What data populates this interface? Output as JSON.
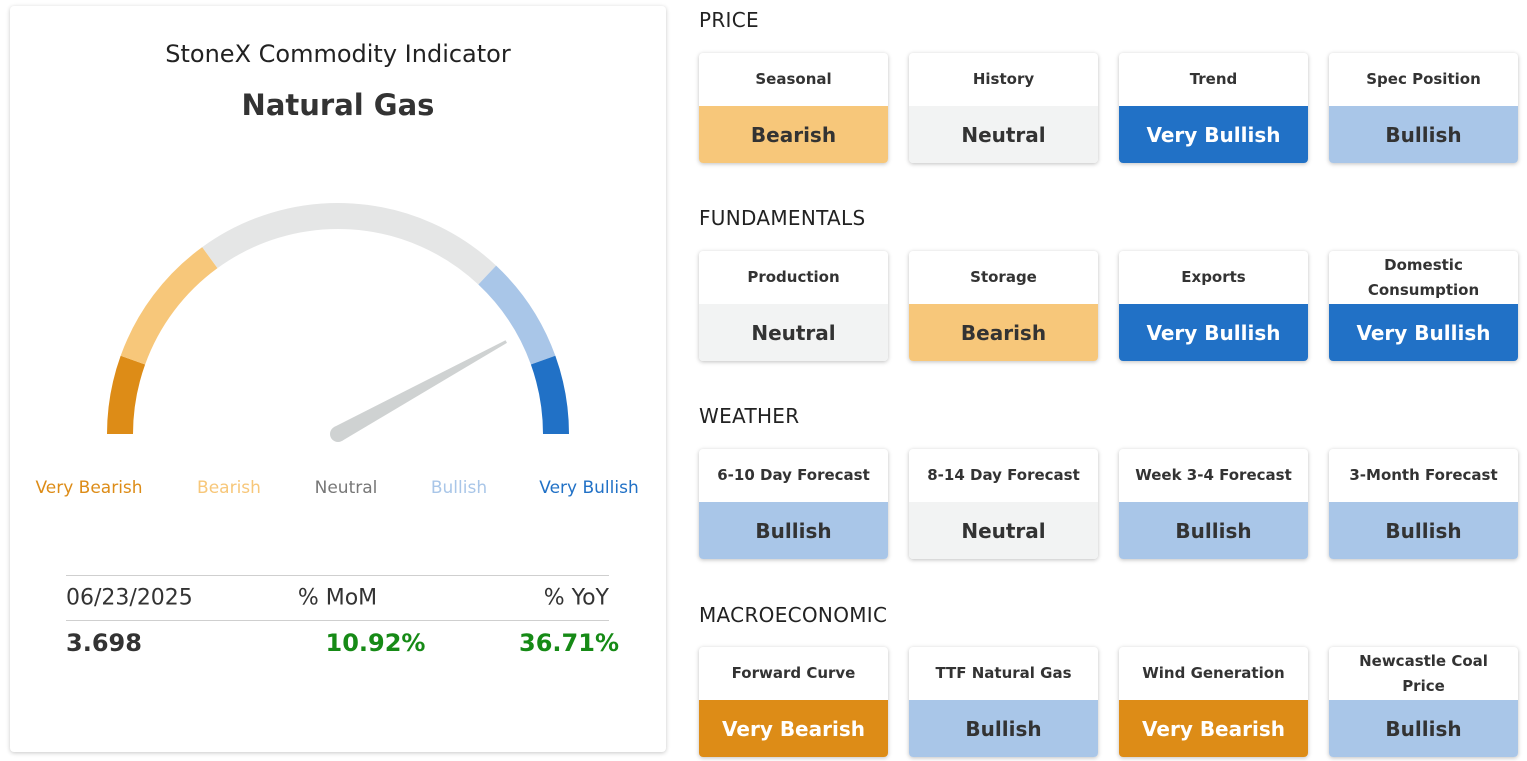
{
  "gauge": {
    "title": "StoneX Commodity Indicator",
    "commodity": "Natural Gas",
    "needle_fraction": 0.84,
    "legend": [
      {
        "label": "Very Bearish",
        "color": "#dd8c17"
      },
      {
        "label": "Bearish",
        "color": "#f7c77a"
      },
      {
        "label": "Neutral",
        "color": "#777777"
      },
      {
        "label": "Bullish",
        "color": "#a9c6e8"
      },
      {
        "label": "Very Bullish",
        "color": "#2171c6"
      }
    ],
    "arc_colors": [
      "#dd8c17",
      "#f7c77a",
      "#e5e6e6",
      "#a9c6e8",
      "#2171c6"
    ]
  },
  "stats": {
    "date": "06/23/2025",
    "mom_label": "% MoM",
    "yoy_label": "% YoY",
    "price": "3.698",
    "mom_value": "10.92%",
    "yoy_value": "36.71%"
  },
  "sections": [
    {
      "title": "PRICE",
      "items": [
        {
          "name": "Seasonal",
          "value": "Bearish"
        },
        {
          "name": "History",
          "value": "Neutral"
        },
        {
          "name": "Trend",
          "value": "Very Bullish"
        },
        {
          "name": "Spec Position",
          "value": "Bullish"
        }
      ]
    },
    {
      "title": "FUNDAMENTALS",
      "items": [
        {
          "name": "Production",
          "value": "Neutral"
        },
        {
          "name": "Storage",
          "value": "Bearish"
        },
        {
          "name": "Exports",
          "value": "Very Bullish"
        },
        {
          "name": "Domestic Consumption",
          "value": "Very Bullish"
        }
      ]
    },
    {
      "title": "WEATHER",
      "items": [
        {
          "name": "6-10 Day Forecast",
          "value": "Bullish"
        },
        {
          "name": "8-14 Day Forecast",
          "value": "Neutral"
        },
        {
          "name": "Week 3-4 Forecast",
          "value": "Bullish"
        },
        {
          "name": "3-Month Forecast",
          "value": "Bullish"
        }
      ]
    },
    {
      "title": "MACROECONOMIC",
      "items": [
        {
          "name": "Forward Curve",
          "value": "Very Bearish"
        },
        {
          "name": "TTF Natural Gas",
          "value": "Bullish"
        },
        {
          "name": "Wind Generation",
          "value": "Very Bearish"
        },
        {
          "name": "Newcastle Coal Price",
          "value": "Bullish"
        }
      ]
    }
  ]
}
